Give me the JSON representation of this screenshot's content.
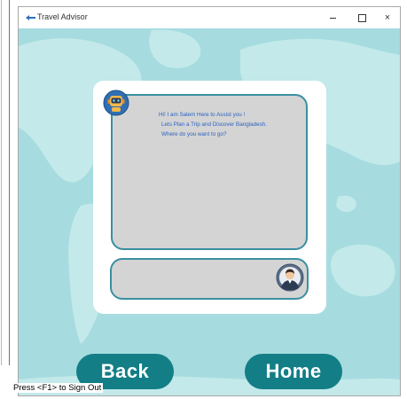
{
  "window": {
    "title": "Travel Advisor",
    "icon": "app-arrow-icon",
    "controls": {
      "minimize": "minimize-icon",
      "maximize": "maximize-icon",
      "close_glyph": "×"
    }
  },
  "chat": {
    "bot_messages": [
      "Hi! I am Salem Here to Assist you !",
      "Lets Plan a Trip and Discover Bangladesh.",
      "Where do you want to go?"
    ],
    "bot_avatar": "robot-avatar-icon",
    "user_avatar": "user-avatar-icon",
    "input_value": ""
  },
  "buttons": {
    "back_label": "Back",
    "home_label": "Home"
  },
  "hint_text": "Press <F1> to Sign Out",
  "colors": {
    "background": "#a6dcdf",
    "accent": "#137e86",
    "chat_border": "#3a8fa1",
    "message_text": "#2a62c2"
  }
}
